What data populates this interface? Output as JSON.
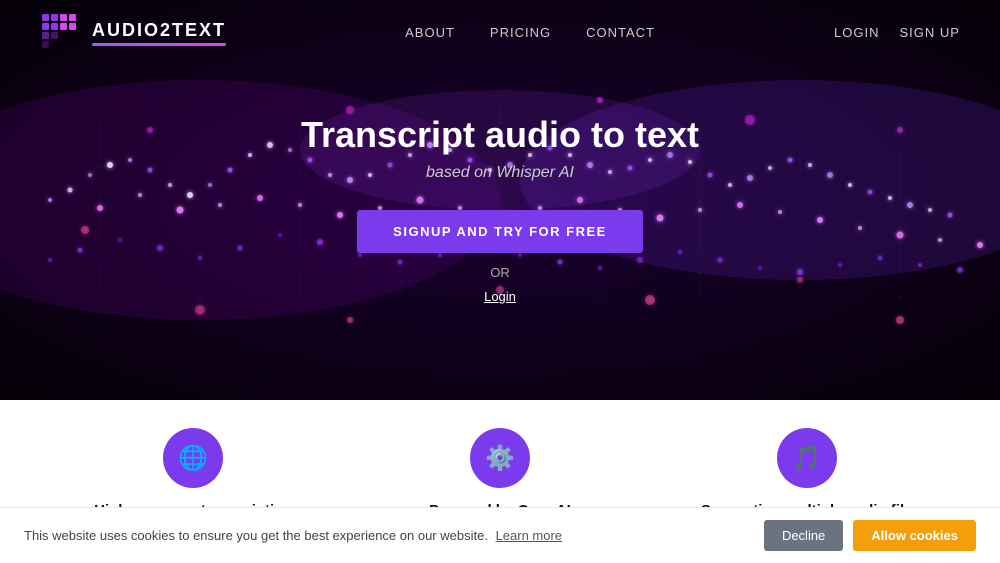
{
  "site": {
    "logo_text": "AUDIO2TEXT",
    "logo_tagline": "~~~"
  },
  "navbar": {
    "links": [
      {
        "label": "ABOUT",
        "id": "about"
      },
      {
        "label": "PRICING",
        "id": "pricing"
      },
      {
        "label": "CONTACT",
        "id": "contact"
      }
    ],
    "auth": [
      {
        "label": "LOGIN",
        "id": "login"
      },
      {
        "label": "SIGN UP",
        "id": "signup"
      }
    ]
  },
  "hero": {
    "title": "Transcript audio to text",
    "subtitle": "based on Whisper AI",
    "cta_label": "SIGNUP AND TRY FOR FREE",
    "or_text": "OR",
    "login_label": "Login"
  },
  "features": [
    {
      "icon": "🌐",
      "title": "High accuracy transcription",
      "id": "accuracy"
    },
    {
      "icon": "⚙",
      "title": "Powered by OpenAI",
      "id": "openai"
    },
    {
      "icon": "♪",
      "title": "Supporting multiple audio file",
      "id": "formats"
    }
  ],
  "cookie": {
    "message": "This website uses cookies to ensure you get the best experience on our website.",
    "learn_more_label": "Learn more",
    "decline_label": "Decline",
    "allow_label": "Allow cookies"
  }
}
